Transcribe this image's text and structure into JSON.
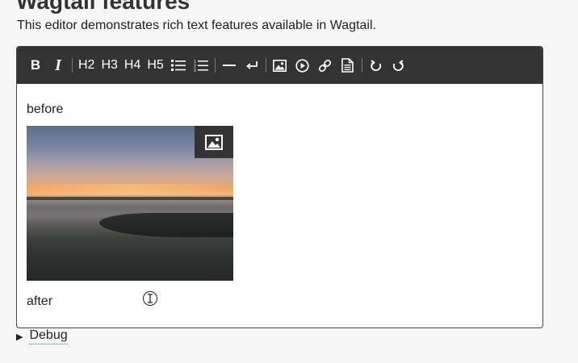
{
  "page": {
    "title": "Wagtail features",
    "intro": "This editor demonstrates rich text features available in Wagtail."
  },
  "toolbar": {
    "bold": "B",
    "italic": "I",
    "h2": "H2",
    "h3": "H3",
    "h4": "H4",
    "h5": "H5"
  },
  "editor": {
    "paragraph_before": "before",
    "paragraph_after": "after"
  },
  "debug": {
    "label": "Debug"
  }
}
